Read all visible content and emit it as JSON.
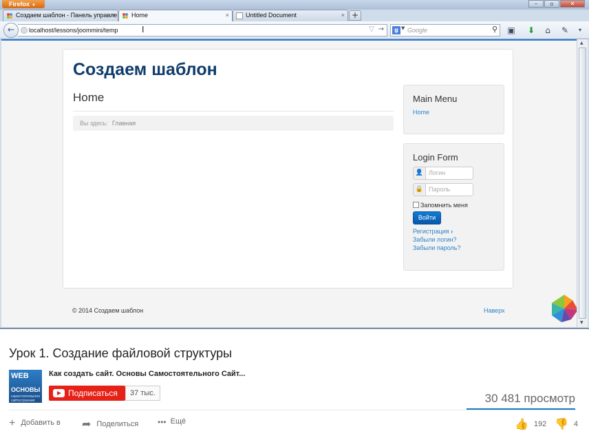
{
  "browser": {
    "menu_label": "Firefox",
    "tabs": [
      {
        "label": "Создаем шаблон - Панель управле...",
        "active": false
      },
      {
        "label": "Home",
        "active": true
      },
      {
        "label": "Untitled Document",
        "active": false
      }
    ],
    "url": "localhost/lessons/joommini/temp",
    "search_placeholder": "Google"
  },
  "site": {
    "brand": "Создаем шаблон",
    "page_title": "Home",
    "breadcrumb_label": "Вы здесь:",
    "breadcrumb_item": "Главная",
    "main_menu": {
      "title": "Main Menu",
      "items": [
        "Home"
      ]
    },
    "login_form": {
      "title": "Login Form",
      "username_placeholder": "Логин",
      "password_placeholder": "Пароль",
      "remember_label": "Запомнить меня",
      "submit_label": "Войти",
      "register_link": "Регистрация",
      "forgot_login_link": "Забыли логин?",
      "forgot_password_link": "Забыли пароль?"
    },
    "footer": {
      "copyright": "© 2014 Создаем шаблон",
      "back_to_top": "Наверх"
    }
  },
  "video": {
    "title": "Урок 1. Создание файловой структуры",
    "channel_name": "Как создать сайт. Основы Самостоятельного Сайт...",
    "channel_avatar": {
      "line1": "WEB",
      "line2": "ОСНОВЫ",
      "line3": "самостоятельного сайтостроения"
    },
    "subscribe_label": "Подписаться",
    "subscriber_count": "37 тыс.",
    "views": "30 481 просмотр",
    "actions": {
      "add": "Добавить в",
      "share": "Поделиться",
      "more": "Ещё"
    },
    "likes": "192",
    "dislikes": "4"
  },
  "colors": {
    "link": "#2a83c9",
    "brand_title": "#0f3c6b",
    "subscribe": "#e62117",
    "views_bar": "#167ac6"
  }
}
